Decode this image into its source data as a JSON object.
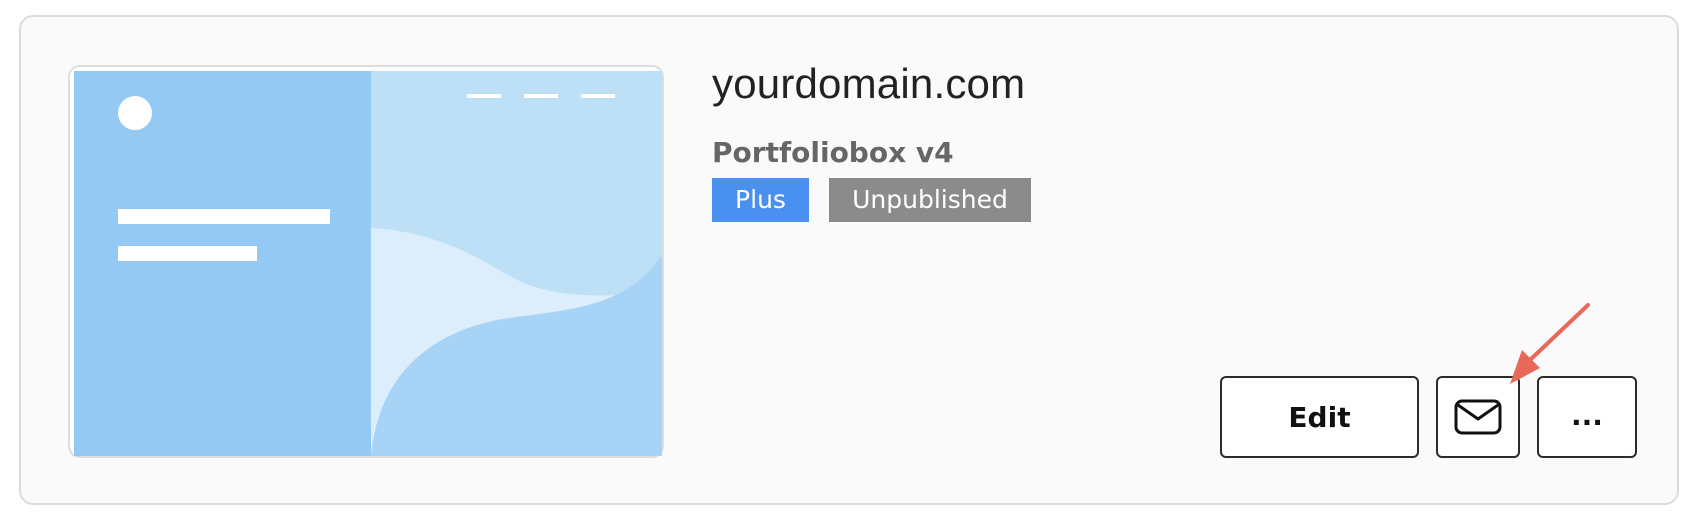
{
  "site": {
    "domain": "yourdomain.com",
    "version": "Portfoliobox v4",
    "badges": {
      "plan": "Plus",
      "status": "Unpublished"
    }
  },
  "actions": {
    "edit_label": "Edit",
    "more_label": "...",
    "mail_icon": "envelope-icon"
  },
  "colors": {
    "plan_badge": "#4a90ee",
    "status_badge": "#8b8b8b",
    "annotation_arrow": "#e8695a",
    "thumb_left_panel": "#93c9f3",
    "thumb_right_panel": "#bee0f7"
  }
}
